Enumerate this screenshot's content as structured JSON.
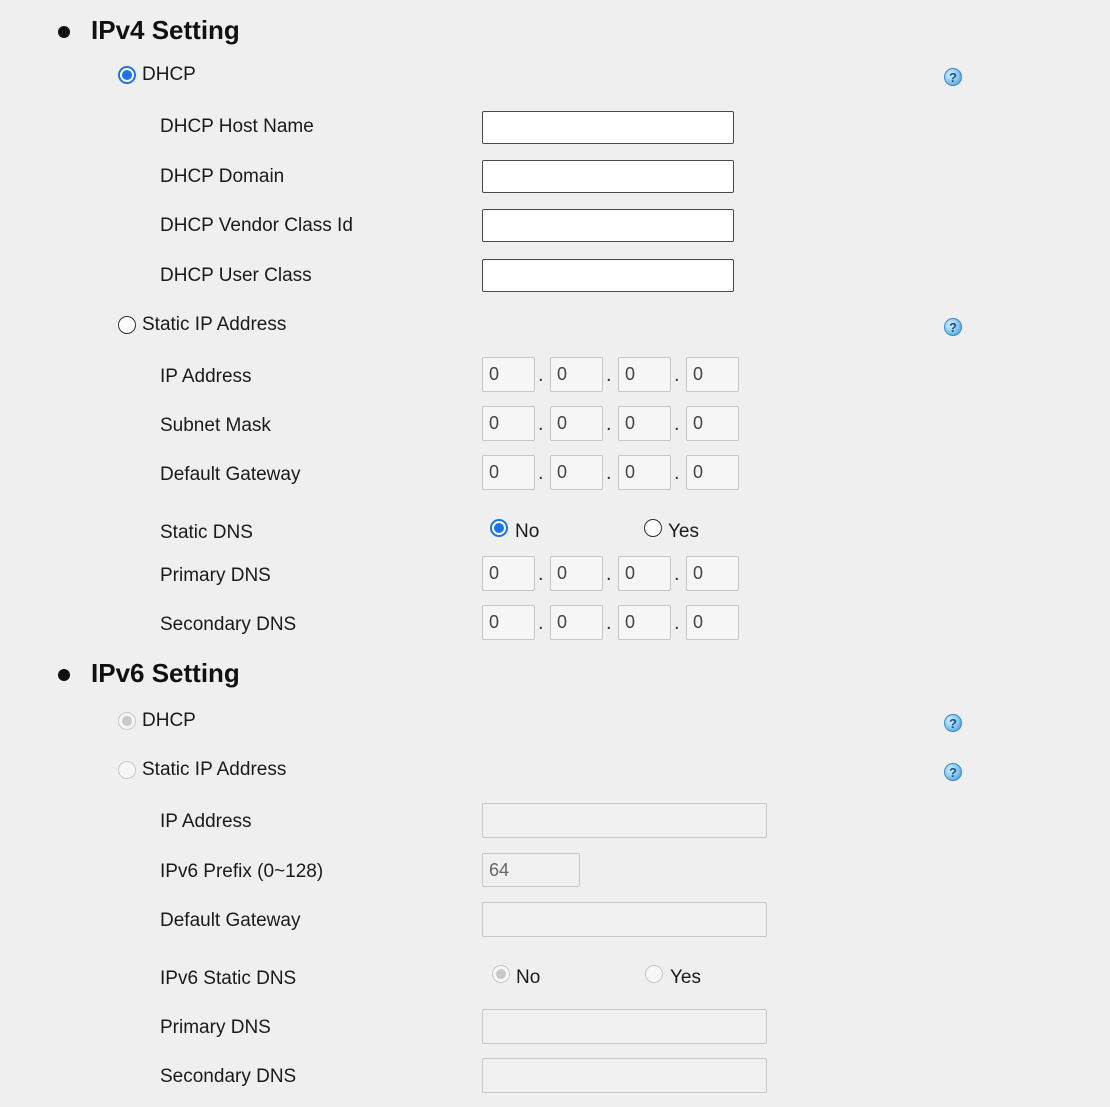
{
  "ipv4": {
    "title": "IPv4 Setting",
    "dhcp_label": "DHCP",
    "dhcp_host_name_label": "DHCP Host Name",
    "dhcp_host_name_value": "",
    "dhcp_domain_label": "DHCP Domain",
    "dhcp_domain_value": "",
    "dhcp_vendor_class_label": "DHCP Vendor Class Id",
    "dhcp_vendor_class_value": "",
    "dhcp_user_class_label": "DHCP User Class",
    "dhcp_user_class_value": "",
    "static_label": "Static IP Address",
    "ip_address_label": "IP Address",
    "ip_address": [
      "0",
      "0",
      "0",
      "0"
    ],
    "subnet_mask_label": "Subnet Mask",
    "subnet_mask": [
      "0",
      "0",
      "0",
      "0"
    ],
    "default_gateway_label": "Default Gateway",
    "default_gateway": [
      "0",
      "0",
      "0",
      "0"
    ],
    "static_dns_label": "Static DNS",
    "static_dns_no": "No",
    "static_dns_yes": "Yes",
    "primary_dns_label": "Primary DNS",
    "primary_dns": [
      "0",
      "0",
      "0",
      "0"
    ],
    "secondary_dns_label": "Secondary DNS",
    "secondary_dns": [
      "0",
      "0",
      "0",
      "0"
    ]
  },
  "ipv6": {
    "title": "IPv6 Setting",
    "dhcp_label": "DHCP",
    "static_label": "Static IP Address",
    "ip_address_label": "IP Address",
    "ip_address_value": "",
    "prefix_label": "IPv6 Prefix (0~128)",
    "prefix_value": "64",
    "default_gateway_label": "Default Gateway",
    "default_gateway_value": "",
    "static_dns_label": "IPv6 Static DNS",
    "static_dns_no": "No",
    "static_dns_yes": "Yes",
    "primary_dns_label": "Primary DNS",
    "primary_dns_value": "",
    "secondary_dns_label": "Secondary DNS",
    "secondary_dns_value": ""
  },
  "help_icon_glyph": "?",
  "accent_color": "#1a73e8"
}
